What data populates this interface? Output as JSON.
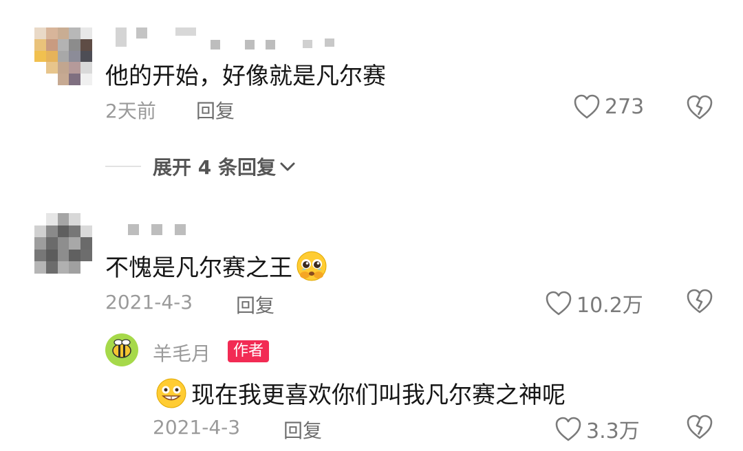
{
  "comments": [
    {
      "text": "他的开始，好像就是凡尔赛",
      "time": "2天前",
      "reply_label": "回复",
      "likes": "273",
      "expand_label": "展开 4 条回复"
    },
    {
      "text": "不愧是凡尔赛之王",
      "time": "2021-4-3",
      "reply_label": "回复",
      "likes": "10.2万",
      "replies": [
        {
          "author": "羊毛月",
          "author_badge": "作者",
          "text": "现在我更喜欢你们叫我凡尔赛之神呢",
          "time": "2021-4-3",
          "reply_label": "回复",
          "likes": "3.3万"
        }
      ]
    }
  ],
  "colors": {
    "badge": "#f22b54",
    "avatar_author": "#a6d94a"
  },
  "icons": [
    "heart-outline-icon",
    "broken-heart-icon",
    "chevron-down-icon",
    "pleading-face-emoji",
    "grinning-face-emoji",
    "bee-avatar"
  ]
}
